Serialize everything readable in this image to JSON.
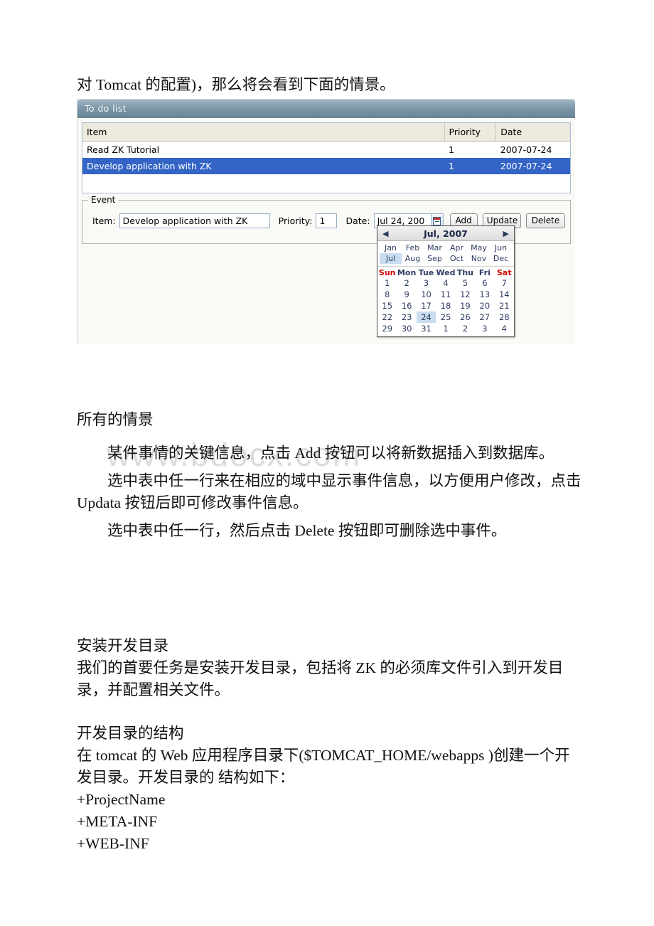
{
  "document": {
    "line_top": "对 Tomcat 的配置)，那么将会看到下面的情景。",
    "heading_scenarios": "所有的情景",
    "para_add": "某件事情的关键信息，点击 Add 按钮可以将新数据插入到数据库。",
    "para_update": "选中表中任一行来在相应的域中显示事件信息，以方便用户修改，点击 Updata 按钮后即可修改事件信息。",
    "para_delete": "选中表中任一行，然后点击 Delete 按钮即可删除选中事件。",
    "heading_install": "安装开发目录",
    "para_install": "我们的首要任务是安装开发目录，包括将 ZK 的必须库文件引入到开发目录，并配置相关文件。",
    "heading_structure": "开发目录的结构",
    "para_structure": "在 tomcat 的 Web 应用程序目录下($TOMCAT_HOME/webapps )创建一个开发目录。开发目录的 结构如下：",
    "tree_1": "+ProjectName",
    "tree_2": "+META-INF",
    "tree_3": "+WEB-INF",
    "watermark": "www.bdocx.com"
  },
  "app": {
    "title": "To do list",
    "grid": {
      "columns": [
        "Item",
        "Priority",
        "Date"
      ],
      "rows": [
        {
          "item": "Read ZK Tutorial",
          "priority": "1",
          "date": "2007-07-24",
          "selected": false
        },
        {
          "item": "Develop application with ZK",
          "priority": "1",
          "date": "2007-07-24",
          "selected": true
        }
      ]
    },
    "form": {
      "legend": "Event",
      "item_label": "Item:",
      "item_value": "Develop application with ZK",
      "priority_label": "Priority:",
      "priority_value": "1",
      "date_label": "Date:",
      "date_value": "Jul 24, 200",
      "calendar_icon": "calendar-icon",
      "add_label": "Add",
      "update_label": "Update",
      "delete_label": "Delete"
    },
    "calendar": {
      "prev_icon": "◀",
      "next_icon": "▶",
      "title": "Jul, 2007",
      "months": [
        "Jan",
        "Feb",
        "Mar",
        "Apr",
        "May",
        "Jun",
        "Jul",
        "Aug",
        "Sep",
        "Oct",
        "Nov",
        "Dec"
      ],
      "selected_month": "Jul",
      "dow": [
        "Sun",
        "Mon",
        "Tue",
        "Wed",
        "Thu",
        "Fri",
        "Sat"
      ],
      "weekend_days": [
        "Sun",
        "Sat"
      ],
      "days": [
        "1",
        "2",
        "3",
        "4",
        "5",
        "6",
        "7",
        "8",
        "9",
        "10",
        "11",
        "12",
        "13",
        "14",
        "15",
        "16",
        "17",
        "18",
        "19",
        "20",
        "21",
        "22",
        "23",
        "24",
        "25",
        "26",
        "27",
        "28",
        "29",
        "30",
        "31",
        "1",
        "2",
        "3",
        "4"
      ],
      "selected_day_index": 23
    },
    "colors": {
      "titlebar": "#7d98a8",
      "selected_row": "#3465c6",
      "header_cell": "#eceadd",
      "calendar_highlight": "#c9dcf0",
      "weekend_text": "#d40000"
    }
  }
}
